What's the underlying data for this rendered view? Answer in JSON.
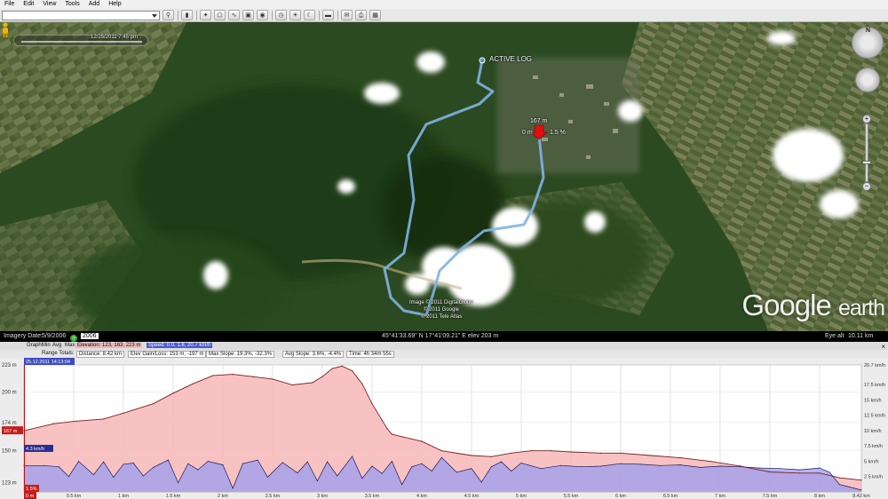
{
  "menu": [
    "File",
    "Edit",
    "View",
    "Tools",
    "Add",
    "Help"
  ],
  "toolbar": {
    "icons": [
      "search-icon",
      "sidebar-icon",
      "placemark-icon",
      "polygon-icon",
      "path-icon",
      "overlay-icon",
      "record-tour-icon",
      "historical-imagery-icon",
      "sunlight-icon",
      "sky-icon",
      "email-icon",
      "print-icon",
      "view-in-maps-icon"
    ]
  },
  "map": {
    "time_label": "12/25/2011    7:45 pm",
    "path_label": "ACTIVE LOG",
    "marker_elev": "167 m",
    "marker_left": "0 m",
    "marker_right": "1.5 %",
    "credits": [
      "Image © 2011 DigitalGlobe",
      "© 2011 Google",
      "© 2011 Tele Atlas"
    ],
    "watermark_main": "Google",
    "watermark_sub": "earth",
    "nav_north": "N"
  },
  "status": {
    "imagery_date_label": "Imagery Date:",
    "imagery_date": "5/9/2006",
    "year": "2006",
    "coords": "45°41'33.69\" N  17°41'09.21\" E  elev   203 m",
    "eye_alt_label": "Eye alt",
    "eye_alt": "10.11 km"
  },
  "profile": {
    "row1": {
      "graph": "Graph:",
      "min": "Min",
      "avg": "Avg",
      "max": "Max",
      "elevation": "Elevation: 123, 163, 223 m",
      "speed": "Speed: 0.0, 1.8, 20.7 km/h"
    },
    "row2": {
      "range_totals": "Range Totals:",
      "distance": "Distance: 8.42 km",
      "elev_gain": "Elev Gain/Loss: 153 m, -197 m",
      "max_slope": "Max Slope: 19.3%, -32.3%",
      "avg_slope": "Avg Slope: 3.6%, -4.4%",
      "time": "Time: 4h 34m 55s"
    },
    "close": "×"
  },
  "chart_data": {
    "type": "area",
    "timestamp": "25.12.2011 14:13:04",
    "cursor_elev_label": "167 m",
    "cursor_slope_label": "1.5%",
    "cursor_zero_label": "0 m",
    "speed_badge": "4.3 km/h",
    "x_unit": "km",
    "x_ticks": [
      "0.5 km",
      "1 km",
      "1.5 km",
      "2 km",
      "2.5 km",
      "3 km",
      "3.5 km",
      "4 km",
      "4.5 km",
      "5 km",
      "5.5 km",
      "6 km",
      "6.5 km",
      "7 km",
      "7.5 km",
      "8 km",
      "8.42 km"
    ],
    "x_tick_values": [
      0.5,
      1,
      1.5,
      2,
      2.5,
      3,
      3.5,
      4,
      4.5,
      5,
      5.5,
      6,
      6.5,
      7,
      7.5,
      8,
      8.42
    ],
    "xlim": [
      0,
      8.42
    ],
    "y_left_ticks": [
      "223 m",
      "200 m",
      "174 m",
      "150 m",
      "123 m"
    ],
    "y_left_tick_values": [
      223,
      200,
      174,
      150,
      123
    ],
    "ylim_left": [
      115,
      223
    ],
    "y_right_ticks": [
      "20.7 km/h",
      "17.5 km/h",
      "15 km/h",
      "12.5 km/h",
      "10 km/h",
      "7.5 km/h",
      "5 km/h",
      "2.5 km/h"
    ],
    "y_right_tick_values": [
      20.7,
      17.5,
      15,
      12.5,
      10,
      7.5,
      5,
      2.5
    ],
    "ylim_right": [
      0,
      20.7
    ],
    "series": [
      {
        "name": "Elevation",
        "color": "#f7b7b7",
        "line_color": "#7a1f1f",
        "x": [
          0,
          0.3,
          0.5,
          0.8,
          1.0,
          1.3,
          1.5,
          1.7,
          1.9,
          2.1,
          2.3,
          2.5,
          2.7,
          2.9,
          3.0,
          3.1,
          3.2,
          3.3,
          3.4,
          3.5,
          3.6,
          3.65,
          3.7,
          3.8,
          4.0,
          4.2,
          4.5,
          4.7,
          4.9,
          5.1,
          5.3,
          5.5,
          5.8,
          6.0,
          6.3,
          6.6,
          6.9,
          7.2,
          7.5,
          7.8,
          8.0,
          8.2,
          8.42
        ],
        "values": [
          167,
          173,
          175,
          177,
          182,
          190,
          199,
          207,
          214,
          215,
          213,
          211,
          206,
          208,
          213,
          220,
          222,
          218,
          207,
          190,
          176,
          169,
          164,
          162,
          158,
          150,
          146,
          145,
          148,
          150,
          150,
          149,
          148,
          148,
          146,
          144,
          141,
          137,
          132,
          131,
          131,
          127,
          125
        ]
      },
      {
        "name": "Speed",
        "color": "#9b9cf0",
        "line_color": "#1a1a55",
        "x": [
          0,
          0.2,
          0.35,
          0.45,
          0.55,
          0.7,
          0.8,
          0.9,
          1.0,
          1.1,
          1.2,
          1.3,
          1.45,
          1.55,
          1.65,
          1.75,
          1.85,
          2.0,
          2.1,
          2.2,
          2.35,
          2.45,
          2.6,
          2.75,
          2.85,
          2.95,
          3.05,
          3.15,
          3.3,
          3.4,
          3.5,
          3.6,
          3.7,
          3.8,
          3.9,
          4.0,
          4.1,
          4.2,
          4.35,
          4.5,
          4.6,
          4.7,
          4.8,
          4.9,
          5.0,
          5.2,
          5.4,
          5.6,
          5.8,
          6.0,
          6.2,
          6.4,
          6.6,
          6.8,
          7.0,
          7.2,
          7.4,
          7.6,
          7.8,
          8.0,
          8.1,
          8.2,
          8.3,
          8.42
        ],
        "values": [
          4.3,
          4.3,
          4.1,
          2.5,
          5.0,
          2.8,
          4.9,
          2.4,
          4.5,
          4.7,
          2.6,
          4.0,
          5.2,
          1.5,
          4.6,
          3.6,
          5.0,
          4.4,
          0.6,
          4.6,
          5.2,
          2.4,
          4.8,
          3.1,
          4.9,
          1.8,
          4.9,
          2.6,
          5.8,
          2.2,
          4.2,
          3.0,
          5.0,
          1.2,
          4.1,
          4.6,
          3.4,
          5.6,
          3.2,
          3.8,
          1.6,
          4.1,
          4.9,
          3.4,
          4.7,
          3.8,
          4.3,
          4.1,
          4.2,
          4.6,
          4.5,
          4.3,
          4.4,
          4.0,
          4.2,
          4.1,
          3.9,
          3.8,
          3.6,
          3.9,
          3.2,
          1.2,
          0.8,
          0.3
        ]
      }
    ],
    "cursor_x": 0
  }
}
